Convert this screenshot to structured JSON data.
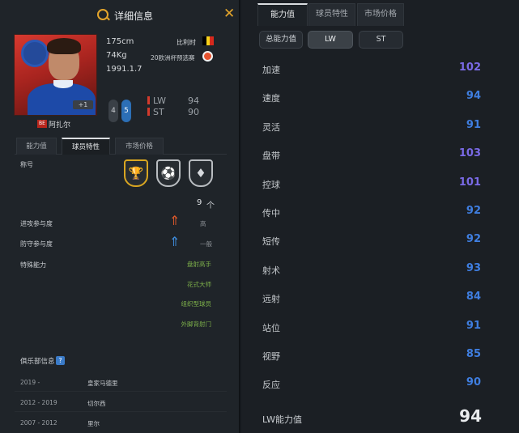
{
  "header": {
    "title": "详细信息"
  },
  "player": {
    "name": "阿扎尔",
    "nation_code": "BE",
    "card_level": "+1",
    "height": "175cm",
    "weight": "74Kg",
    "birth": "1991.1.7",
    "nationality": "比利时",
    "tournament": "20欧洲杯预选赛",
    "weak_foot": "4",
    "strong_foot": "5",
    "positions": [
      {
        "pos": "LW",
        "value": "94"
      },
      {
        "pos": "ST",
        "value": "90"
      }
    ],
    "flag_colors": [
      "#000000",
      "#f5d21a",
      "#d72a1c"
    ]
  },
  "left_tabs": [
    "能力值",
    "球员特性",
    "市场价格"
  ],
  "left_active_tab": 1,
  "traits": {
    "label": "称号",
    "icons": [
      "trophy-icon",
      "dribbler-icon",
      "shield-player-icon"
    ],
    "count": "9",
    "count_unit": "个"
  },
  "work_rate": {
    "attack_label": "进攻参与度",
    "attack_value": "高",
    "defense_label": "防守参与度",
    "defense_value": "一般"
  },
  "special": {
    "label": "特殊能力",
    "skills": [
      "盘射高手",
      "花式大师",
      "组织型球员",
      "外脚背射门"
    ]
  },
  "club": {
    "header": "俱乐部信息",
    "help": "?",
    "history": [
      {
        "years": "2019 -",
        "club": "皇家马德里"
      },
      {
        "years": "2012 - 2019",
        "club": "切尔西"
      },
      {
        "years": "2007 - 2012",
        "club": "里尔"
      }
    ]
  },
  "right_tabs": [
    "能力值",
    "球员特性",
    "市场价格"
  ],
  "right_active_tab": 0,
  "filters": [
    "总能力值",
    "LW",
    "ST"
  ],
  "active_filter": 1,
  "stats": [
    {
      "label": "加速",
      "value": "102"
    },
    {
      "label": "速度",
      "value": "94"
    },
    {
      "label": "灵活",
      "value": "91"
    },
    {
      "label": "盘带",
      "value": "103"
    },
    {
      "label": "控球",
      "value": "101"
    },
    {
      "label": "传中",
      "value": "92"
    },
    {
      "label": "短传",
      "value": "92"
    },
    {
      "label": "射术",
      "value": "93"
    },
    {
      "label": "远射",
      "value": "84"
    },
    {
      "label": "站位",
      "value": "91"
    },
    {
      "label": "视野",
      "value": "85"
    },
    {
      "label": "反应",
      "value": "90"
    }
  ],
  "total": {
    "label": "LW能力值",
    "value": "94"
  },
  "colors": {
    "accent": "#e4a52b",
    "stat_blue": "#3f7ee0",
    "stat_purple": "#7a6ae6",
    "skill_green": "#7db04a",
    "attack_arrow": "#e25a2a",
    "defense_arrow": "#3f8fe0"
  }
}
